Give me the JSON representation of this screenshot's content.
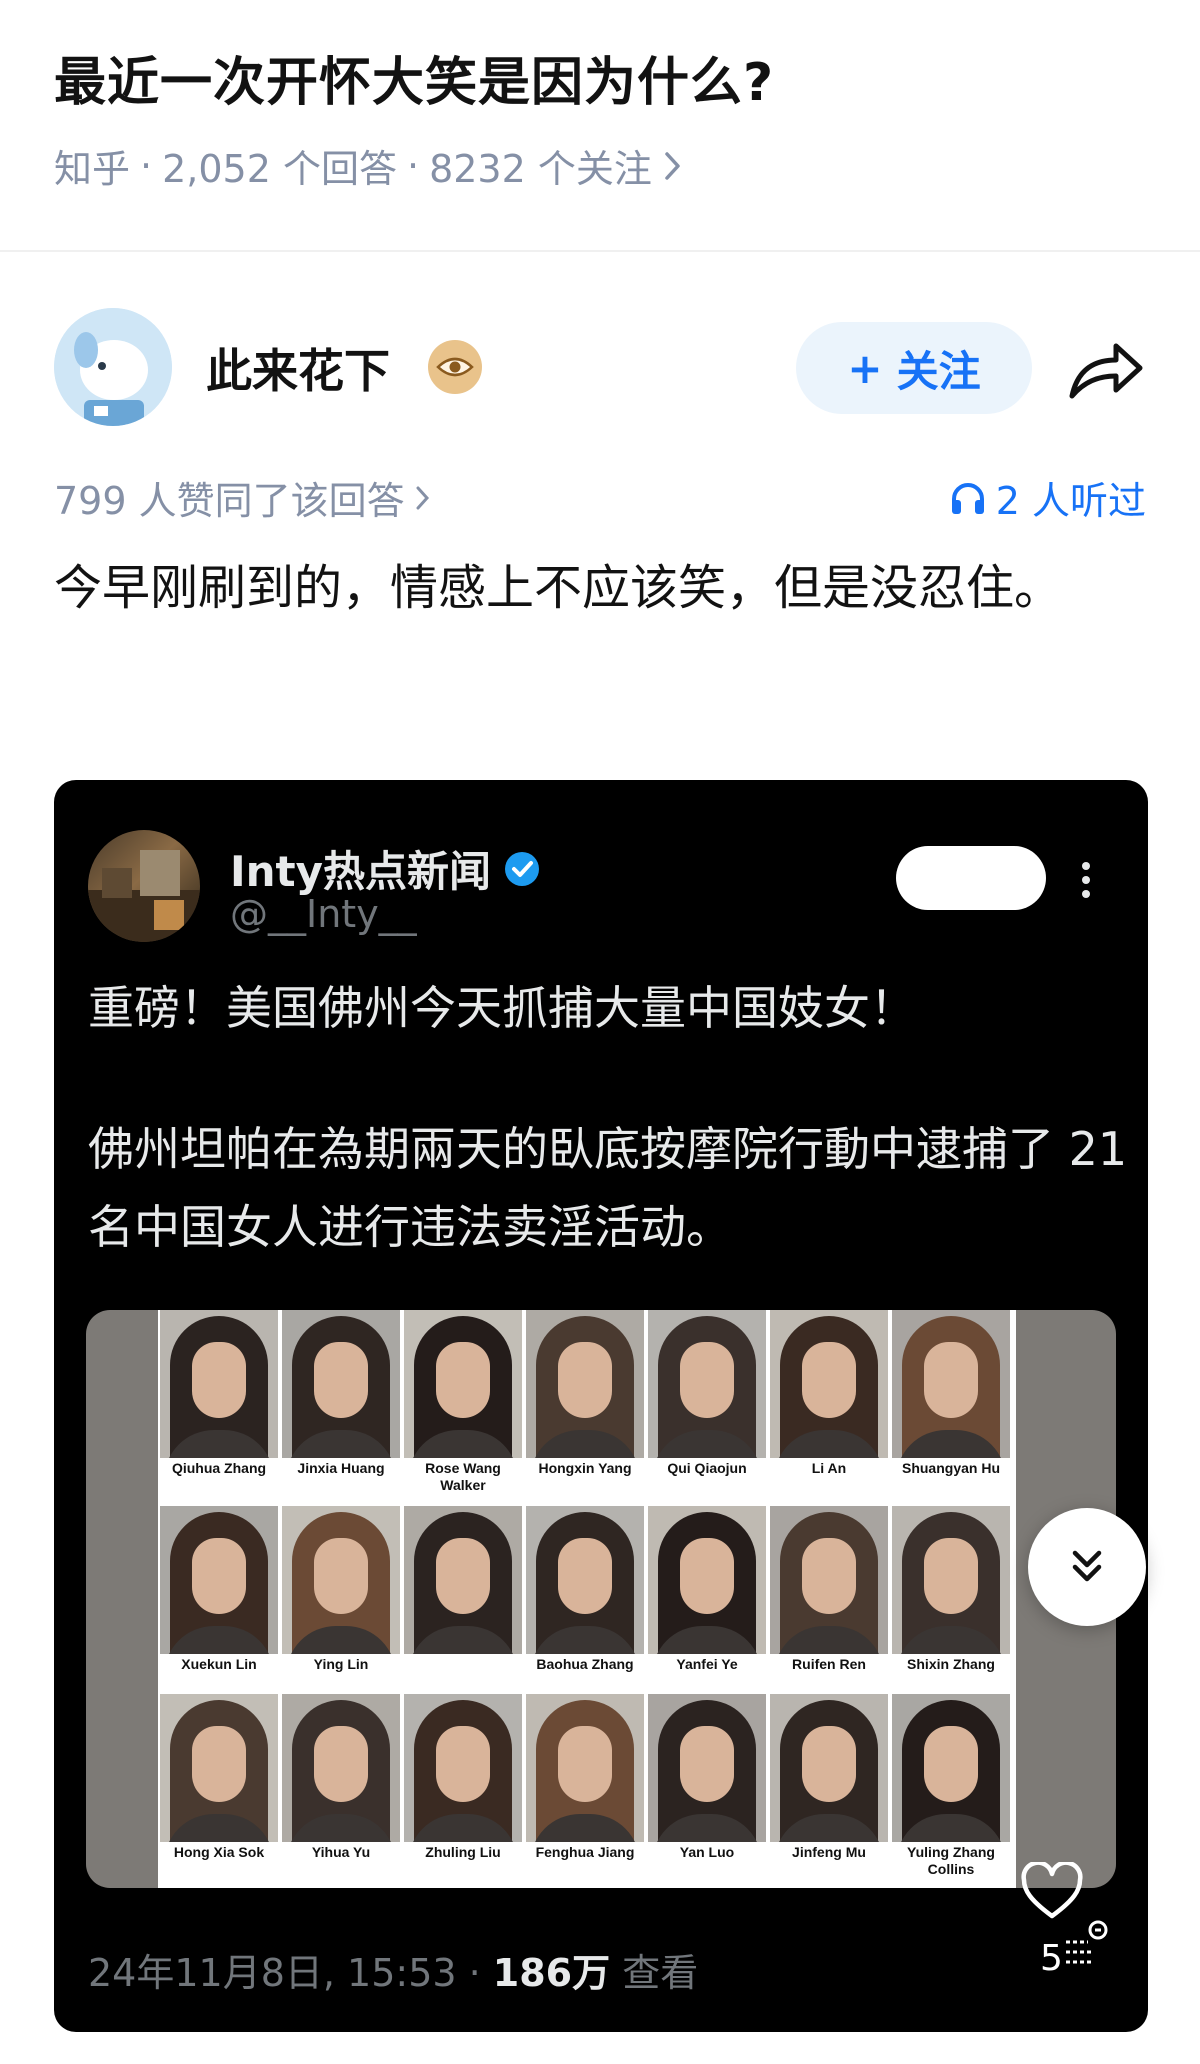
{
  "question": {
    "title": "最近一次开怀大笑是因为什么?",
    "source": "知乎",
    "answers_count": "2,052 个回答",
    "follows_count": "8232 个关注",
    "separator": "·"
  },
  "author": {
    "name": "此来花下",
    "follow_label": "关注",
    "follow_plus": "+"
  },
  "answer": {
    "agree_text": "799 人赞同了该回答",
    "listen_text": "2 人听过",
    "body": "今早刚刷到的，情感上不应该笑，但是没忍住。"
  },
  "tweet": {
    "display_name": "Inty热点新闻",
    "handle": "@__Inty__",
    "line1": "重磅！美国佛州今天抓捕大量中国妓女！",
    "line2": "佛州坦帕在為期兩天的臥底按摩院行動中逮捕了 21 名中国女人进行违法卖淫活动。",
    "timestamp": "24年11月8日, 15:53 · ",
    "views": "186万",
    "views_label": " 查看",
    "mugshots": [
      [
        "Qiuhua Zhang",
        "Jinxia Huang",
        "Rose Wang Walker",
        "Hongxin Yang",
        "Qui Qiaojun",
        "Li An",
        "Shuangyan Hu"
      ],
      [
        "Xuekun Lin",
        "Ying Lin",
        "",
        "Baohua Zhang",
        "Yanfei Ye",
        "Ruifen Ren",
        "Shixin Zhang"
      ],
      [
        "Hong Xia Sok",
        "Yihua Yu",
        "Zhuling Liu",
        "Fenghua Jiang",
        "Yan Luo",
        "Jinfeng Mu",
        "Yuling Zhang Collins"
      ]
    ]
  },
  "overlay": {
    "like_count": "5"
  },
  "colors": {
    "accent": "#1772f6",
    "meta_gray": "#8590a6",
    "tweet_bg": "#000000",
    "follow_bg": "#ebf4fc"
  }
}
